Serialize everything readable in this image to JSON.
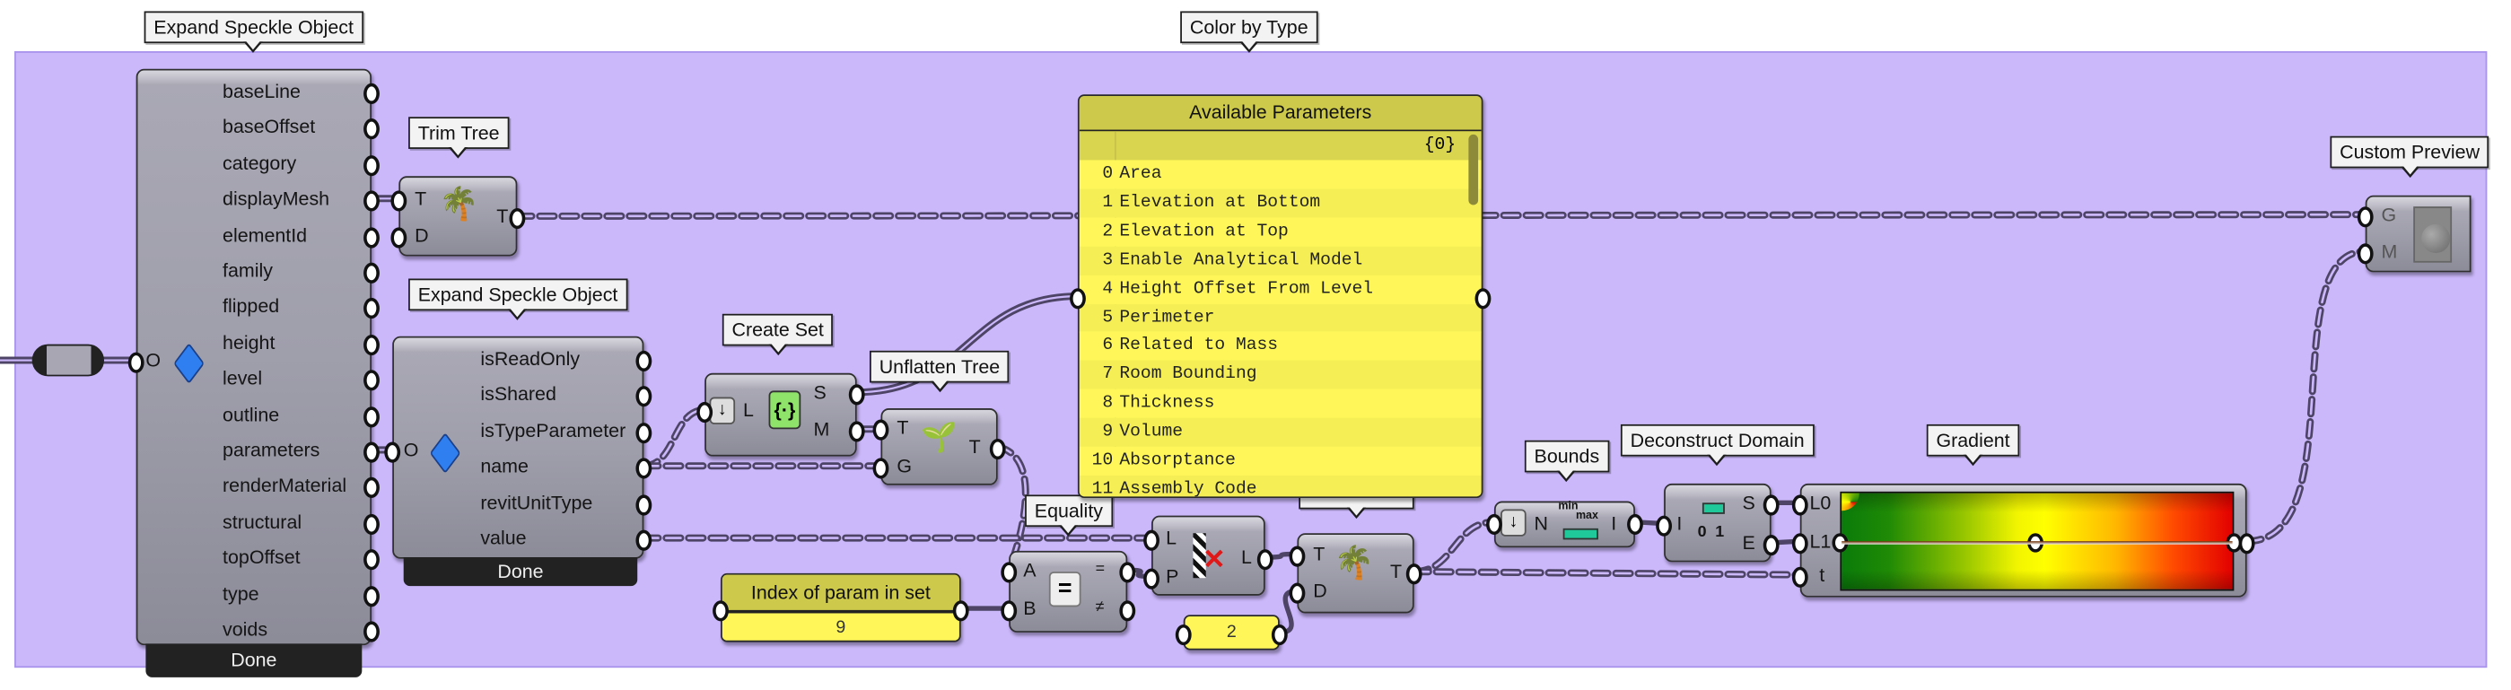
{
  "colors": {
    "canvas_group": "#cbb8fb",
    "panel_yellow": "#fff75a",
    "panel_header": "#cdc94a",
    "component_gray": "#9f9eab",
    "wire": "#4d4466"
  },
  "expand1": {
    "tooltip": "Expand Speckle Object",
    "input": "O",
    "icon": "speckle-cube-icon",
    "outputs": [
      "baseLine",
      "baseOffset",
      "category",
      "displayMesh",
      "elementId",
      "family",
      "flipped",
      "height",
      "level",
      "outline",
      "parameters",
      "renderMaterial",
      "structural",
      "topOffset",
      "type",
      "voids"
    ],
    "status": "Done"
  },
  "trim1": {
    "tooltip": "Trim Tree",
    "inputs": [
      "T",
      "D"
    ],
    "output": "T",
    "icon": "trim-tree-icon"
  },
  "expand2": {
    "tooltip": "Expand Speckle Object",
    "input": "O",
    "icon": "speckle-cube-icon",
    "outputs": [
      "isReadOnly",
      "isShared",
      "isTypeParameter",
      "name",
      "revitUnitType",
      "value"
    ],
    "status": "Done"
  },
  "create_set": {
    "tooltip": "Create Set",
    "input": "L",
    "outputs": [
      "S",
      "M"
    ],
    "icon": "create-set-icon"
  },
  "unflatten": {
    "tooltip": "Unflatten Tree",
    "inputs": [
      "T",
      "G"
    ],
    "output": "T",
    "icon": "unflatten-tree-icon"
  },
  "color_by_type": {
    "tooltip": "Color by Type"
  },
  "params_panel": {
    "title": "Available Parameters",
    "path": "{0}",
    "items": [
      {
        "i": "0",
        "t": "Area"
      },
      {
        "i": "1",
        "t": "Elevation at Bottom"
      },
      {
        "i": "2",
        "t": "Elevation at Top"
      },
      {
        "i": "3",
        "t": "Enable Analytical Model"
      },
      {
        "i": "4",
        "t": "Height Offset From Level"
      },
      {
        "i": "5",
        "t": "Perimeter"
      },
      {
        "i": "6",
        "t": "Related to Mass"
      },
      {
        "i": "7",
        "t": "Room Bounding"
      },
      {
        "i": "8",
        "t": "Thickness"
      },
      {
        "i": "9",
        "t": "Volume"
      },
      {
        "i": "10",
        "t": "Absorptance"
      },
      {
        "i": "11",
        "t": "Assembly Code"
      }
    ]
  },
  "equality": {
    "tooltip": "Equality",
    "inputs": [
      "A",
      "B"
    ],
    "outputs": [
      "=",
      "≠"
    ],
    "icon": "equals-icon"
  },
  "index_panel": {
    "title": "Index of param in set",
    "value": "9"
  },
  "cull": {
    "inputs": [
      "L",
      "P"
    ],
    "output": "L",
    "icon": "cull-pattern-icon"
  },
  "trim2": {
    "inputs": [
      "T",
      "D"
    ],
    "output": "T",
    "icon": "trim-tree-icon"
  },
  "depth_panel": {
    "value": "2"
  },
  "bounds": {
    "tooltip": "Bounds",
    "input": "N",
    "output": "I",
    "icon_min": "min",
    "icon_max": "max"
  },
  "deconstruct": {
    "tooltip": "Deconstruct Domain",
    "input": "I",
    "outputs": [
      "S",
      "E"
    ],
    "icon_a": "0",
    "icon_b": "1"
  },
  "gradient": {
    "tooltip": "Gradient",
    "inputs": [
      "L0",
      "L1",
      "t"
    ],
    "colors": [
      "#0a7b0a",
      "#ffff00",
      "#e20000"
    ]
  },
  "custom_preview": {
    "tooltip": "Custom Preview",
    "inputs": [
      "G",
      "M"
    ],
    "icon": "custom-preview-icon"
  }
}
